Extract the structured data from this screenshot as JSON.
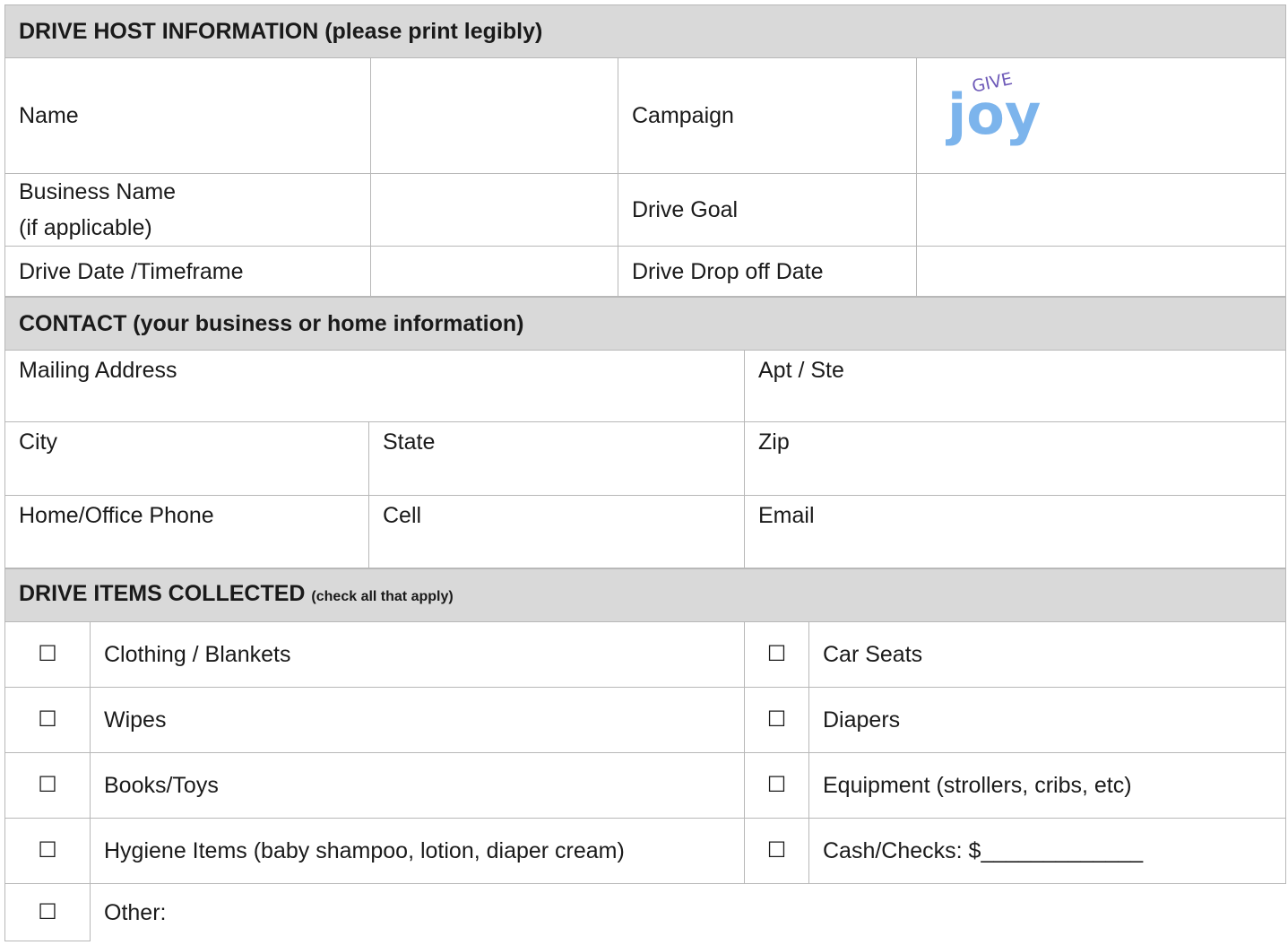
{
  "host": {
    "header": "DRIVE HOST INFORMATION (please print legibly)",
    "name_label": "Name",
    "campaign_label": "Campaign",
    "logo_text_top": "GIVE",
    "logo_text_main": "joy",
    "business_label_1": "Business Name",
    "business_label_2": "(if applicable)",
    "goal_label": "Drive Goal",
    "date_label": "Drive Date /Timeframe",
    "dropoff_label": "Drive Drop off Date"
  },
  "contact": {
    "header": "CONTACT (your business or home information)",
    "mailing_label": "Mailing Address",
    "apt_label": "Apt / Ste",
    "city_label": "City",
    "state_label": "State",
    "zip_label": "Zip",
    "phone_label": "Home/Office Phone",
    "cell_label": "Cell",
    "email_label": "Email"
  },
  "items": {
    "header": "DRIVE ITEMS COLLECTED",
    "header_note": "(check all that apply)",
    "checkbox_glyph": "☐",
    "rows": [
      {
        "left": "Clothing / Blankets",
        "right": "Car Seats"
      },
      {
        "left": "Wipes",
        "right": "Diapers"
      },
      {
        "left": "Books/Toys",
        "right": "Equipment (strollers, cribs, etc)"
      },
      {
        "left": "Hygiene Items (baby shampoo, lotion, diaper cream)",
        "right": "Cash/Checks: $_____________"
      }
    ],
    "other_label": "Other:"
  },
  "colors": {
    "header_bg": "#d9d9d9",
    "logo_blue": "#7cb4ec",
    "logo_purple": "#6e5ab8"
  }
}
